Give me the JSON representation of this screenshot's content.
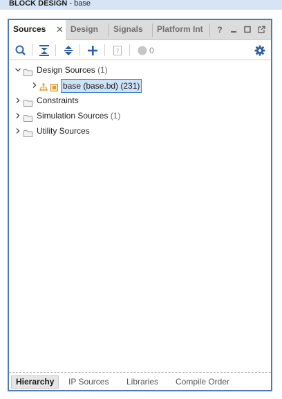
{
  "window": {
    "title_bold": "BLOCK DESIGN",
    "title_rest": " - base"
  },
  "tabs": [
    {
      "label": "Sources",
      "active": true
    },
    {
      "label": "Design"
    },
    {
      "label": "Signals"
    },
    {
      "label": "Platform Int"
    }
  ],
  "tab_controls": {
    "help": "?",
    "minimize": "_",
    "maximize": "□",
    "float": "⧉"
  },
  "toolbar": {
    "message_count": "0"
  },
  "tree": {
    "design_sources": {
      "label": "Design Sources",
      "count": "(1)"
    },
    "base": {
      "label": "base (base.bd) (231)"
    },
    "constraints": {
      "label": "Constraints"
    },
    "simulation_sources": {
      "label": "Simulation Sources",
      "count": "(1)"
    },
    "utility_sources": {
      "label": "Utility Sources"
    }
  },
  "bottom_tabs": [
    {
      "label": "Hierarchy",
      "active": true
    },
    {
      "label": "IP Sources"
    },
    {
      "label": "Libraries"
    },
    {
      "label": "Compile Order"
    }
  ],
  "colors": {
    "accent": "#4e79b8",
    "selection": "#cde3f7",
    "gear": "#2d5ea8"
  }
}
